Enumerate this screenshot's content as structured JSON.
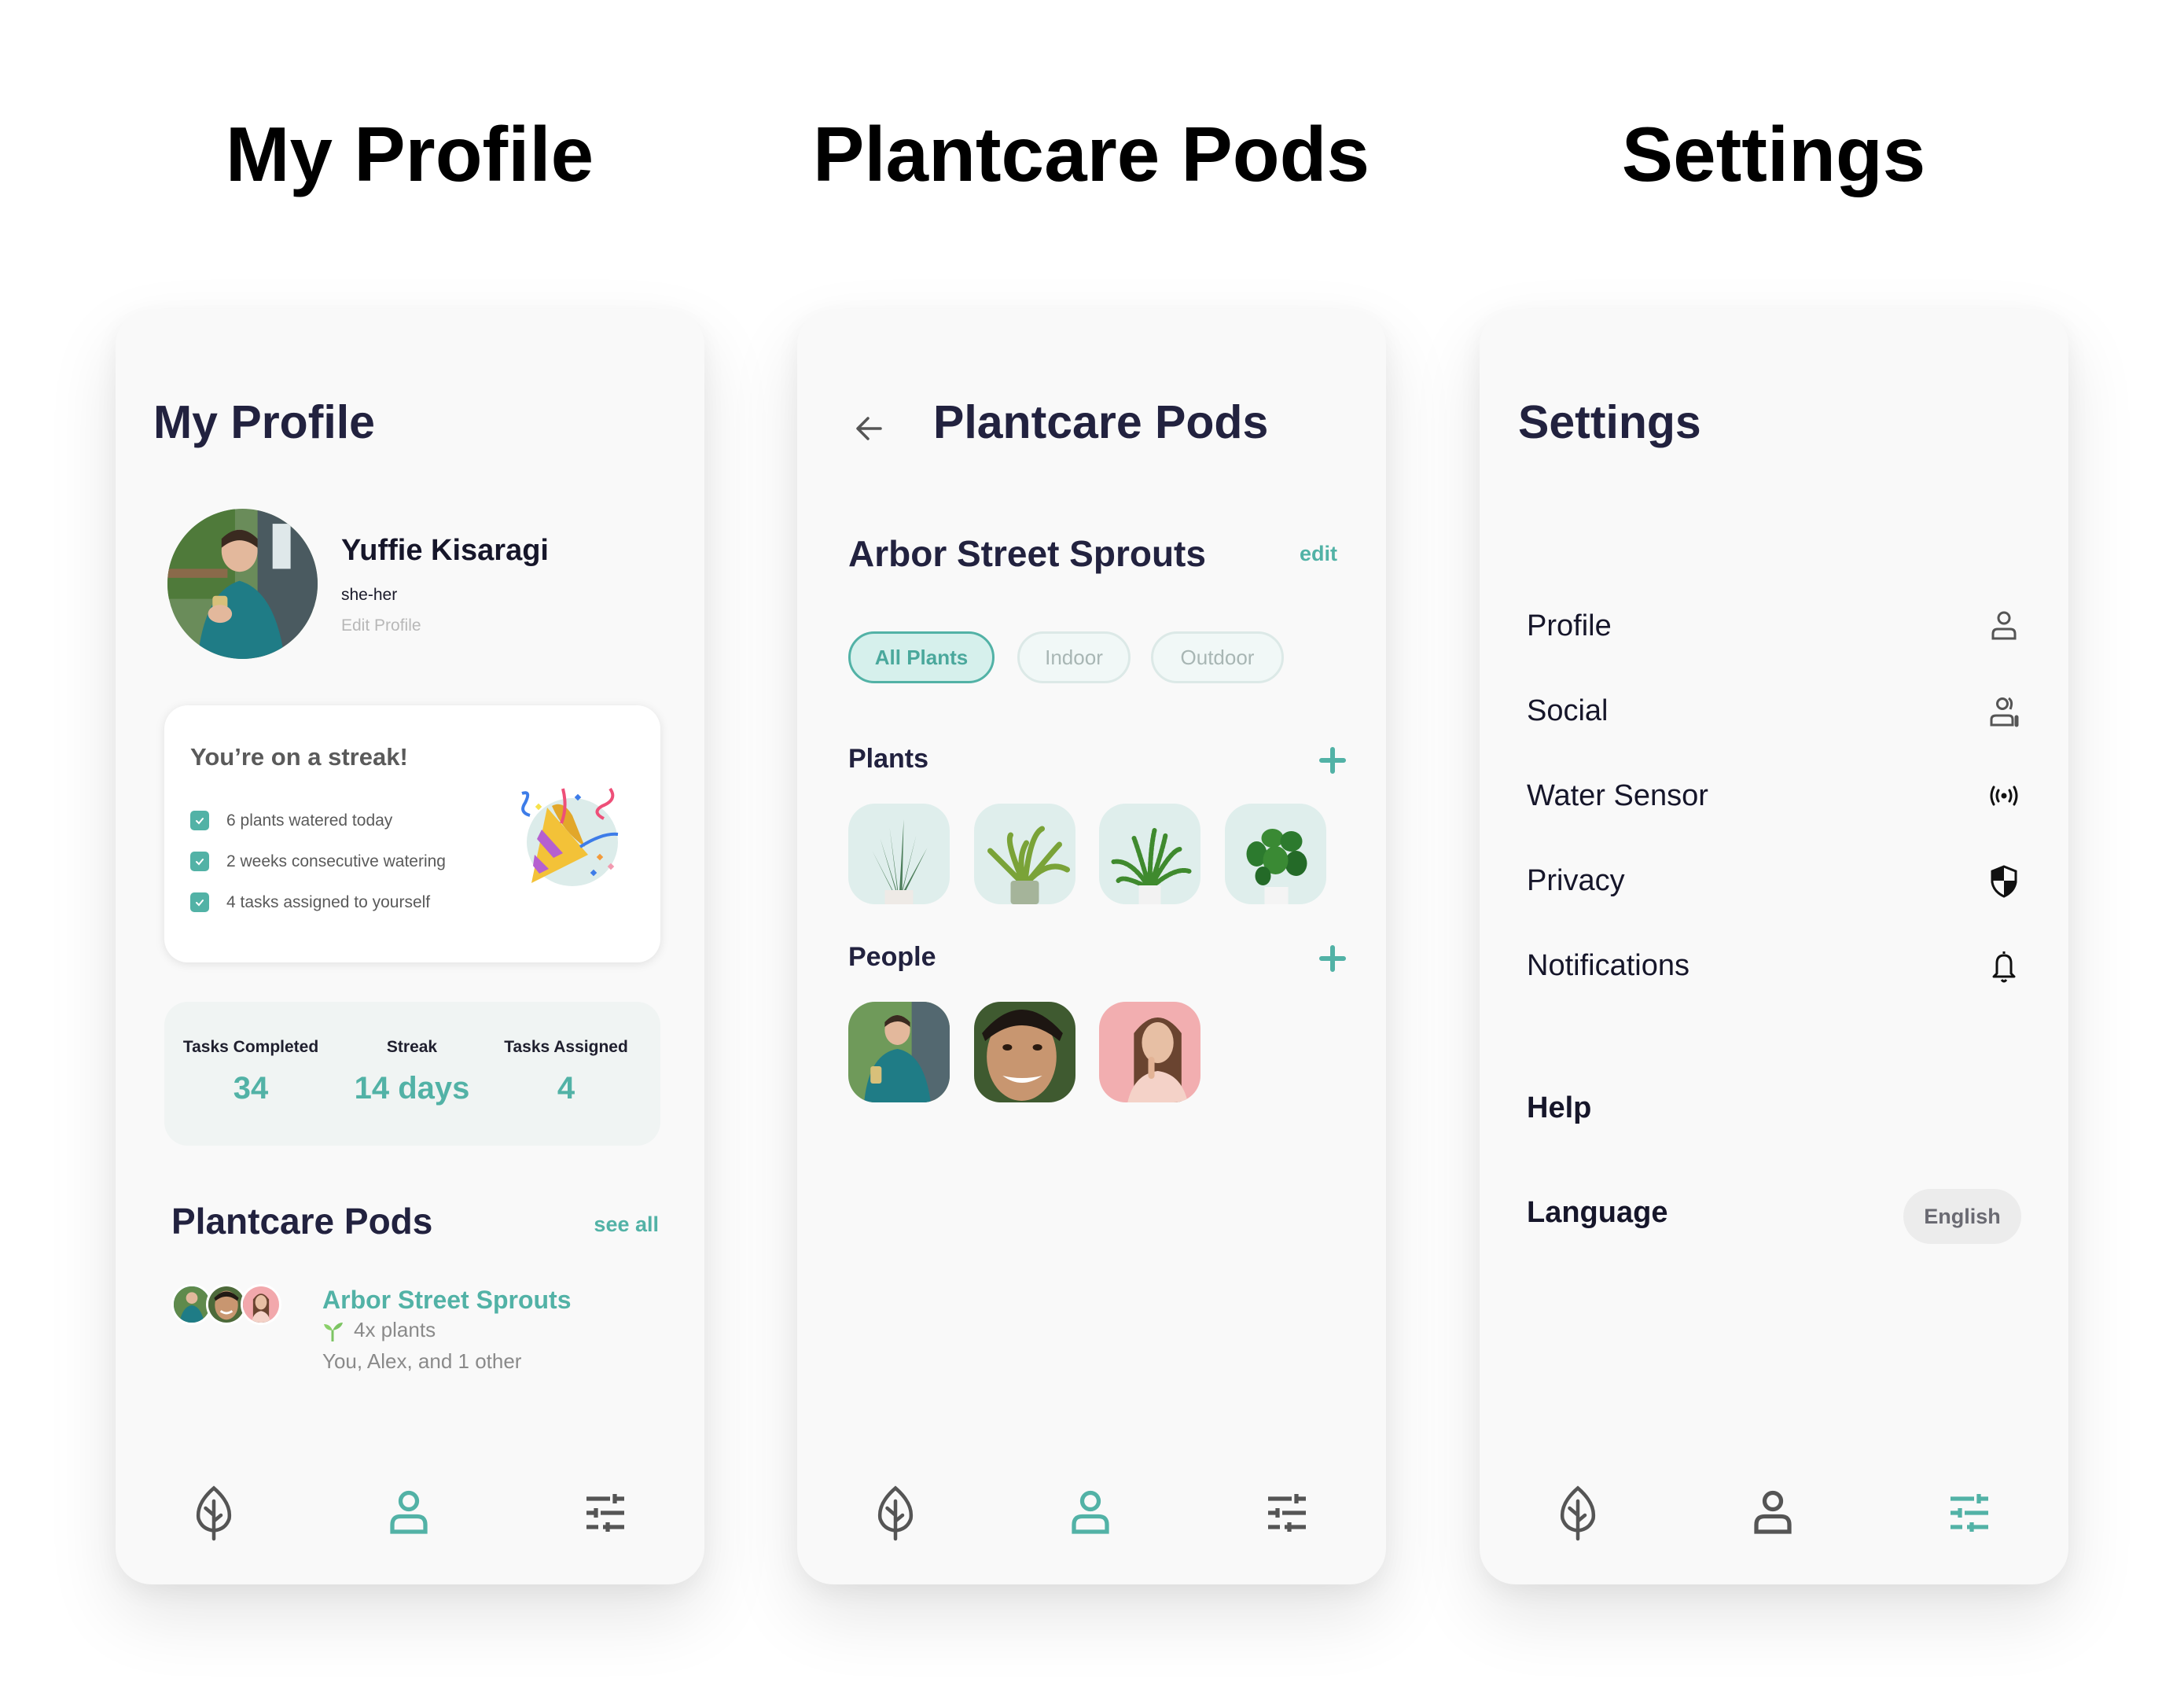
{
  "headings": [
    "My Profile",
    "Plantcare Pods",
    "Settings"
  ],
  "colors": {
    "accent": "#52b2a6",
    "text_dark": "#22223f",
    "card_bg": "#f9f9f9",
    "icon_gray": "#555555"
  },
  "profile": {
    "title": "My Profile",
    "name": "Yuffie Kisaragi",
    "pronouns": "she-her",
    "edit_profile": "Edit Profile",
    "streak": {
      "title": "You’re on a streak!",
      "items": [
        "6 plants watered today",
        "2 weeks consecutive watering",
        "4 tasks assigned to yourself"
      ],
      "icon": "party-popper-icon"
    },
    "stats": [
      {
        "label": "Tasks Completed",
        "value": "34"
      },
      {
        "label": "Streak",
        "value": "14 days"
      },
      {
        "label": "Tasks Assigned",
        "value": "4"
      }
    ],
    "pods_heading": "Plantcare Pods",
    "see_all": "see all",
    "pod": {
      "name": "Arbor Street Sprouts",
      "plants": "4x plants",
      "members": "You, Alex, and 1 other"
    }
  },
  "pods": {
    "title": "Plantcare Pods",
    "pod_name": "Arbor Street Sprouts",
    "edit": "edit",
    "filters": [
      {
        "label": "All Plants",
        "active": true
      },
      {
        "label": "Indoor",
        "active": false
      },
      {
        "label": "Outdoor",
        "active": false
      }
    ],
    "plants_heading": "Plants",
    "plants": [
      "aloe",
      "bird's nest fern",
      "boston fern",
      "pilea"
    ],
    "people_heading": "People",
    "people": [
      "Yuffie",
      "Alex",
      "other member"
    ]
  },
  "settings": {
    "title": "Settings",
    "items": [
      {
        "label": "Profile",
        "icon": "person-icon"
      },
      {
        "label": "Social",
        "icon": "people-icon"
      },
      {
        "label": "Water Sensor",
        "icon": "broadcast-icon"
      },
      {
        "label": "Privacy",
        "icon": "shield-icon"
      },
      {
        "label": "Notifications",
        "icon": "bell-icon"
      }
    ],
    "help": "Help",
    "language_label": "Language",
    "language_value": "English"
  },
  "nav": {
    "items": [
      "plants",
      "profile",
      "settings"
    ],
    "active_by_screen": [
      "profile",
      "profile",
      "settings"
    ]
  }
}
